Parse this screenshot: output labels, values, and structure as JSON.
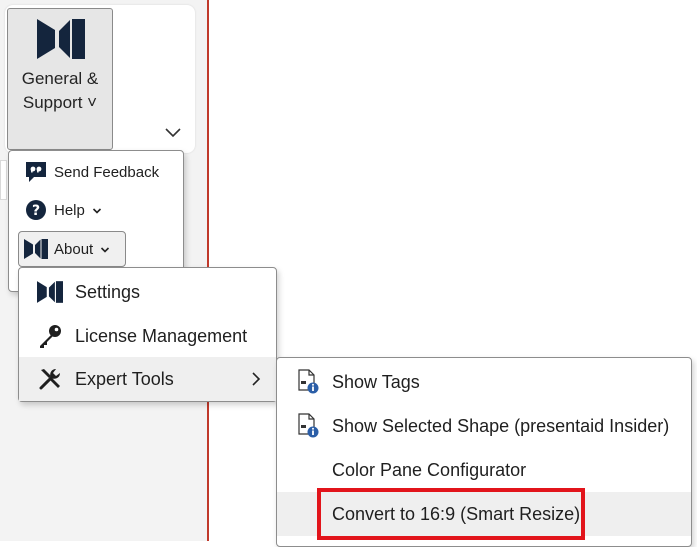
{
  "ribbon": {
    "general_support_label": "General &\nSupport ˅",
    "icons": {
      "logo": "presentaid-logo-icon",
      "collapse": "chevron-down-icon"
    }
  },
  "menu_general": {
    "items": [
      {
        "label": "Send Feedback",
        "icon": "feedback-bubble-icon"
      },
      {
        "label": "Help",
        "icon": "help-circle-icon",
        "has_dropdown": true
      },
      {
        "label": "About",
        "icon": "presentaid-logo-icon",
        "has_dropdown": true
      }
    ]
  },
  "menu_about": {
    "items": [
      {
        "label": "Settings",
        "icon": "presentaid-logo-icon"
      },
      {
        "label": "License Management",
        "icon": "key-icon"
      },
      {
        "label": "Expert Tools",
        "icon": "tools-icon",
        "has_submenu": true
      }
    ]
  },
  "menu_expert": {
    "items": [
      {
        "label": "Show Tags",
        "icon": "document-info-icon"
      },
      {
        "label": "Show Selected Shape (presentaid Insider)",
        "icon": "document-info-icon"
      },
      {
        "label": "Color Pane Configurator",
        "icon": ""
      },
      {
        "label": "Convert to 16:9 (Smart Resize)",
        "icon": "",
        "highlighted": true
      }
    ]
  },
  "colors": {
    "brand_navy": "#14253d",
    "highlight_red": "#e2141b",
    "pane_border": "#c0392b"
  }
}
